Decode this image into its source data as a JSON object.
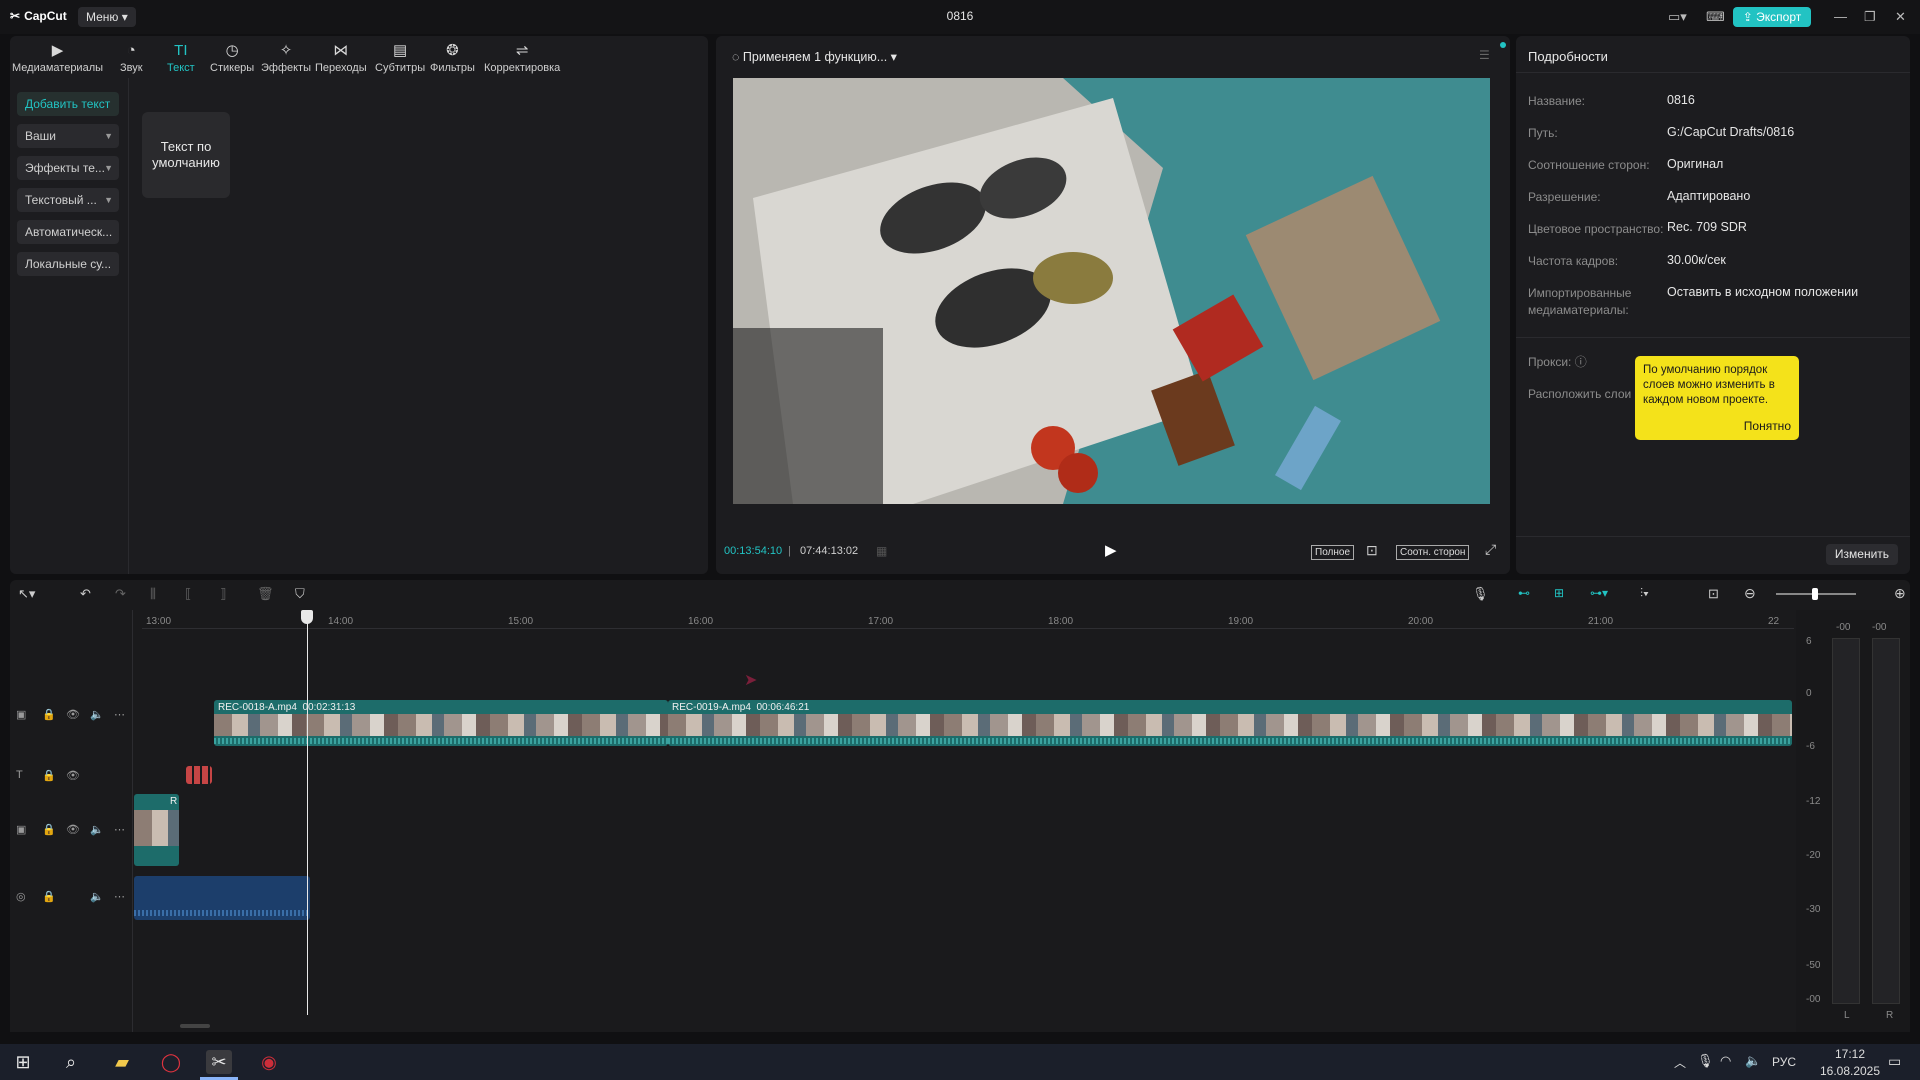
{
  "window": {
    "app_name": "CapCut",
    "menu_label": "Меню",
    "title": "0816",
    "export_label": "Экспорт"
  },
  "toolbar": {
    "tabs": [
      {
        "label": "Медиаматериалы",
        "icon": "media-icon"
      },
      {
        "label": "Звук",
        "icon": "audio-icon"
      },
      {
        "label": "Текст",
        "icon": "text-icon"
      },
      {
        "label": "Стикеры",
        "icon": "sticker-icon"
      },
      {
        "label": "Эффекты",
        "icon": "effects-icon"
      },
      {
        "label": "Переходы",
        "icon": "transitions-icon"
      },
      {
        "label": "Субтитры",
        "icon": "subtitles-icon"
      },
      {
        "label": "Фильтры",
        "icon": "filters-icon"
      },
      {
        "label": "Корректировка",
        "icon": "adjust-icon"
      }
    ],
    "active_tab": "Текст"
  },
  "sidebar": {
    "items": [
      {
        "label": "Добавить текст"
      },
      {
        "label": "Ваши"
      },
      {
        "label": "Эффекты те..."
      },
      {
        "label": "Текстовый ..."
      },
      {
        "label": "Автоматическ..."
      },
      {
        "label": "Локальные су..."
      }
    ],
    "card_label": "Текст по умолчанию"
  },
  "preview": {
    "status": "Применяем 1 функцию...",
    "current_time": "00:13:54:10",
    "total_time": "07:44:13:02",
    "full_label": "Полное",
    "ratio_label": "Соотн. сторон"
  },
  "details": {
    "title": "Подробности",
    "rows": [
      {
        "label": "Название:",
        "value": "0816"
      },
      {
        "label": "Путь:",
        "value": "G:/CapCut Drafts/0816"
      },
      {
        "label": "Соотношение сторон:",
        "value": "Оригинал"
      },
      {
        "label": "Разрешение:",
        "value": "Адаптировано"
      },
      {
        "label": "Цветовое пространство:",
        "value": "Rec. 709 SDR"
      },
      {
        "label": "Частота кадров:",
        "value": "30.00к/сек"
      },
      {
        "label": "Импортированные медиаматериалы:",
        "value": "Оставить в исходном положении"
      }
    ],
    "proxy_label": "Прокси:",
    "layers_label": "Расположить слои",
    "tooltip_text": "По умолчанию порядок слоев можно изменить в каждом новом проекте.",
    "tooltip_ok": "Понятно",
    "change_label": "Изменить"
  },
  "timeline": {
    "ruler": [
      "13:00",
      "14:00",
      "15:00",
      "16:00",
      "17:00",
      "18:00",
      "19:00",
      "20:00",
      "21:00",
      "22"
    ],
    "clips": [
      {
        "name": "REC-0018-A.mp4",
        "duration": "00:02:31:13"
      },
      {
        "name": "REC-0019-A.mp4",
        "duration": "00:06:46:21"
      }
    ],
    "small_clip_label": "R",
    "vu_scale": [
      "6",
      "0",
      "-6",
      "-12",
      "-20",
      "-30",
      "-50",
      "-00"
    ],
    "vu_top": [
      "-00",
      "-00"
    ],
    "vu_channels": [
      "L",
      "R"
    ]
  },
  "taskbar": {
    "lang": "РУС",
    "time": "17:12",
    "date": "16.08.2025"
  },
  "colors": {
    "accent": "#22c3c3",
    "tooltip": "#f4e21a",
    "clip": "#1d6c6a",
    "audio": "#1c3e6b"
  }
}
